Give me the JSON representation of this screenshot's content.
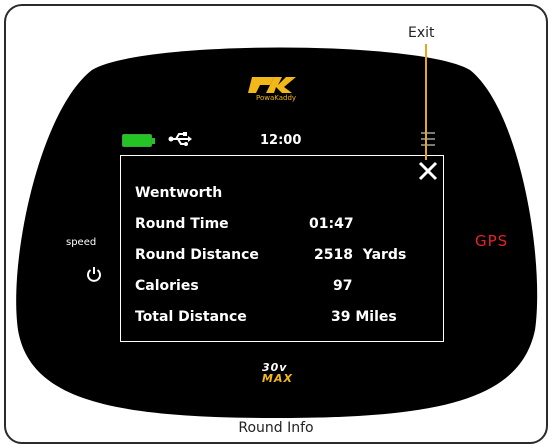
{
  "annotation": {
    "exit_label": "Exit",
    "caption": "Round Info"
  },
  "device": {
    "brand": "PowaKaddy",
    "model_line1": "30v",
    "model_line2": "MAX",
    "left_label": "speed",
    "right_label": "GPS",
    "colors": {
      "accent_yellow": "#f2b718",
      "gps_red": "#e8222a",
      "battery_green": "#23c423",
      "exit_line": "#e6a817"
    }
  },
  "status_bar": {
    "battery_icon": "battery-full-icon",
    "usb_icon": "usb-icon",
    "time": "12:00",
    "menu_icon": "menu-icon"
  },
  "round_info": {
    "course": "Wentworth",
    "rows": [
      {
        "label": "Round Time",
        "value": "01:47"
      },
      {
        "label": "Round Distance",
        "value": "2518  Yards"
      },
      {
        "label": "Calories",
        "value": "97"
      },
      {
        "label": "Total Distance",
        "value": "39 Miles"
      }
    ],
    "close_icon": "close-icon"
  }
}
